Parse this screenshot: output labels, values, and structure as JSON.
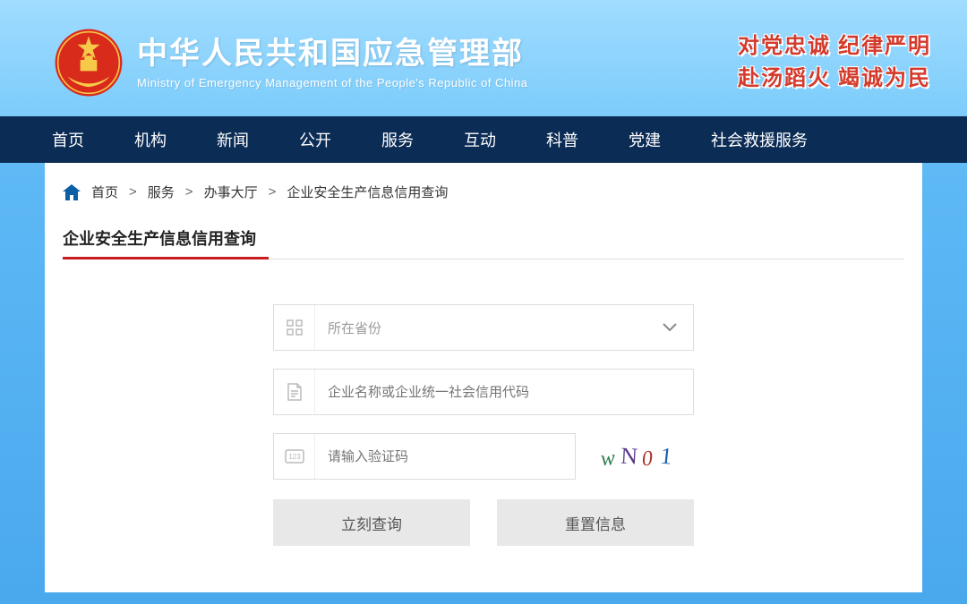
{
  "header": {
    "title": "中华人民共和国应急管理部",
    "subtitle": "Ministry of Emergency Management of the People's Republic of China",
    "slogan_line1": "对党忠诚 纪律严明",
    "slogan_line2": "赴汤蹈火 竭诚为民"
  },
  "nav": {
    "items": [
      "首页",
      "机构",
      "新闻",
      "公开",
      "服务",
      "互动",
      "科普",
      "党建",
      "社会救援服务"
    ]
  },
  "breadcrumb": {
    "items": [
      "首页",
      "服务",
      "办事大厅",
      "企业安全生产信息信用查询"
    ]
  },
  "section": {
    "title": "企业安全生产信息信用查询"
  },
  "form": {
    "province_placeholder": "所在省份",
    "name_placeholder": "企业名称或企业统一社会信用代码",
    "captcha_placeholder": "请输入验证码",
    "captcha_text": "wN01",
    "submit_label": "立刻查询",
    "reset_label": "重置信息"
  }
}
